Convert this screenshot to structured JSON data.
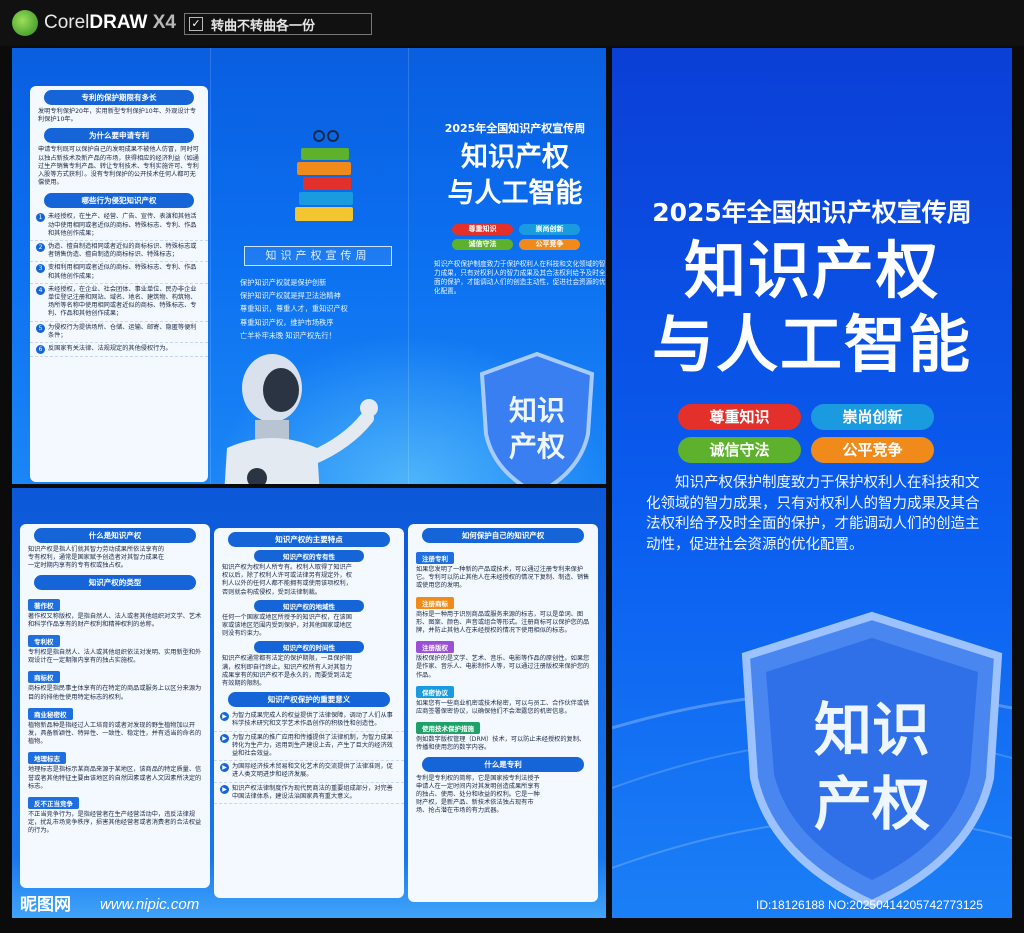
{
  "app": {
    "name_a": "Corel",
    "name_b": "DRAW",
    "version": "X4",
    "checkbox_mark": "✓",
    "curve_label": "转曲不转曲各一份"
  },
  "colors": {
    "red": "#e3302b",
    "blue": "#1a9be0",
    "green": "#5db12c",
    "orange": "#ef8a1b"
  },
  "outside": {
    "col1": {
      "s1_title": "专利的保护期限有多长",
      "s1_text": "发明专利保护20年，实用新型专利保护10年、外观设计专利保护10年。",
      "s2_title": "为什么要申请专利",
      "s2_text": "申请专利既可以保护自己的发明成果不被他人仿冒，同时可以独占新技术及新产品的市场，获得相应的经济利益（如通过生产销售专利产品、转让专利技术、专利实施许可、专利入股等方式获利）。没有专利保护的公开技术任何人都可无偿使用。",
      "s3_title": "哪些行为侵犯知识产权",
      "items": [
        {
          "n": "1",
          "t": "未经授权，在生产、经营、广告、宣传、表演和其他活动中使用相同或者近似的商标、特殊标志、专利、作品和其他创作成果；"
        },
        {
          "n": "2",
          "t": "伪造、擅自制造相同或者近似的商标标识、特殊标志或者销售伪造、擅自制造的商标标识、特殊标志；"
        },
        {
          "n": "3",
          "t": "变相利用相同或者近似的商标、特殊标志、专利、作品和其他创作成果；"
        },
        {
          "n": "4",
          "t": "未经授权，在企业、社会团体、事业单位、民办非企业单位登记注册和网站、域名、地名、建筑物、构筑物、场所等名称中使用相同或者近似的商标、特殊标志、专利、作品和其他创作成果；"
        },
        {
          "n": "5",
          "t": "为侵权行为提供场所、仓储、运输、邮寄、隐匿等便利条件；"
        },
        {
          "n": "6",
          "t": "反国家有关法律、法规规定的其他侵权行为。"
        }
      ]
    },
    "brand": "知识产权宣传周",
    "slogans": [
      "保护知识产权就是保护创新",
      "保护知识产权就是捍卫法治精神",
      "尊重知识，尊重人才，重知识产权",
      "尊重知识产权，维护市场秩序",
      "亡羊补牢未晚  知识产权先行！"
    ],
    "year": "2025年全国知识产权宣传周",
    "title1": "知识产权",
    "title2": "与人工智能",
    "pills": [
      "尊重知识",
      "崇尚创新",
      "诚信守法",
      "公平竞争"
    ],
    "body": "知识产权保护制度致力于保护权利人在科技和文化领域的智力成果，只有对权利人的智力成果及其合法权利给予及时全面的保护，才能调动人们的创造主动性，促进社会资源的优化配置。",
    "shield_1": "知识",
    "shield_2": "产权"
  },
  "inside": {
    "c1": {
      "t1": "什么是知识产权",
      "p1": "知识产权是指人们就其智力劳动成果所依法享有的专有权利，通常是国家赋予创造者对其智力成果在一定时期内享有的专有权或独占权。",
      "t2": "知识产权的类型",
      "types": [
        {
          "h": "著作权",
          "t": "著作权又称版权，是指自然人、法人或者其他组织对文学、艺术和科学作品享有的财产权利和精神权利的总称。"
        },
        {
          "h": "专利权",
          "t": "专利权是指自然人、法人或其他组织依法对发明、实用新型和外观设计在一定期限内享有的独占实施权。"
        },
        {
          "h": "商标权",
          "t": "商标权是指民事主体享有的在特定的商品或服务上以区分来源为目的的排他性使用特定标志的权利。"
        },
        {
          "h": "商业秘密权",
          "t": "植物新品种是指经过人工培育的或者对发现的野生植物加以开发，具备新颖性、特异性、一致性、稳定性，并有适当的命名的植物。"
        },
        {
          "h": "地理标志",
          "t": "地理标志是指标示某商品来源于某地区，该商品的特定质量、信誉或者其他特征主要由该地区的自然因素或者人文因素所决定的标志。"
        },
        {
          "h": "反不正当竞争",
          "t": "不正当竞争行为，是指经营者在生产经营活动中，违反法律规定，扰乱市场竞争秩序，损害其他经营者或者消费者的合法权益的行为。"
        }
      ]
    },
    "c2": {
      "t1": "知识产权的主要特点",
      "f": [
        {
          "h": "知识产权的专有性",
          "t": "知识产权为权利人所专有。权利人取得了知识产权以后，除了权利人许可或法律另有规定外，权利人以外的任何人都不能拥有或使用该项权利，否则就会构成侵权，受到法律制裁。"
        },
        {
          "h": "知识产权的地域性",
          "t": "任何一个国家或地区所授予的知识产权，在该国家或该地区范围内受到保护，对其他国家或地区则没有约束力。"
        },
        {
          "h": "知识产权的时间性",
          "t": "知识产权通常都有法定的保护期限，一旦保护期满，权利即自行终止。知识产权所有人对其智力成果享有的知识产权不是永久的，而要受到法定有效期的限制。"
        }
      ],
      "t2": "知识产权保护的重要意义",
      "meaning": [
        "为智力成果完成人的权益提供了法律保障，调动了人们从事科学技术研究和文学艺术作品创作的积极性和创造性。",
        "为智力成果的推广应用和传播提供了法律机制，为智力成果转化为生产力，运用到生产建设上去，产生了巨大的经济效益和社会效益。",
        "为国际经济技术贸易和文化艺术的交流提供了法律准则，促进人类文明进步和经济发展。",
        "知识产权法律制度作为现代民商法的重要组成部分，对完善中国法律体系，建设法治国家具有重大意义。"
      ]
    },
    "c3": {
      "t1": "如何保护自己的知识产权",
      "ways": [
        {
          "h": "注册专利",
          "t": "如果您发明了一种新的产品或技术，可以通过注册专利来保护它。专利可以防止其他人在未经授权的情况下复制、制造、销售或使用您的发明。"
        },
        {
          "h": "注册商标",
          "t": "商标是一种用于识别商品或服务来源的标志，可以是单词、图形、图案、颜色、声音或组合等形式。注册商标可以保护您的品牌，并防止其他人在未经授权的情况下使用相似的标志。"
        },
        {
          "h": "注册版权",
          "t": "版权保护的是文学、艺术、音乐、电影等作品的原创性。如果您是作家、音乐人、电影制作人等，可以通过注册版权来保护您的作品。"
        },
        {
          "h": "保密协议",
          "t": "如果您有一些商业机密或技术秘密，可以与员工、合作伙伴或供应商签署保密协议，以确保他们不会泄露您的机密信息。"
        },
        {
          "h": "使用技术保护措施",
          "t": "例如数字版权管理（DRM）技术，可以防止未经授权的复制、传播和使用您的数字内容。"
        }
      ],
      "t2": "什么是专利",
      "p2": "专利是专利权的简称，它是国家按专利法授予申请人在一定时间内对其发明创造成果所享有的独占、使用、处分和收益的权利。它是一种财产权，是新产品、新技术依法独占现有市场、抢占潜在市场的有力武器。"
    }
  },
  "cover": {
    "year": "2025年全国知识产权宣传周",
    "title1": "知识产权",
    "title2": "与人工智能",
    "pills": [
      "尊重知识",
      "崇尚创新",
      "诚信守法",
      "公平竞争"
    ],
    "body": "知识产权保护制度致力于保护权利人在科技和文化领域的智力成果，只有对权利人的智力成果及其合法权利给予及时全面的保护，才能调动人们的创造主动性，促进社会资源的优化配置。",
    "shield_1": "知识",
    "shield_2": "产权"
  },
  "footer": {
    "mark": "昵图网",
    "url": "www.nipic.com",
    "id": "ID:18126188 NO:20250414205742773125"
  }
}
